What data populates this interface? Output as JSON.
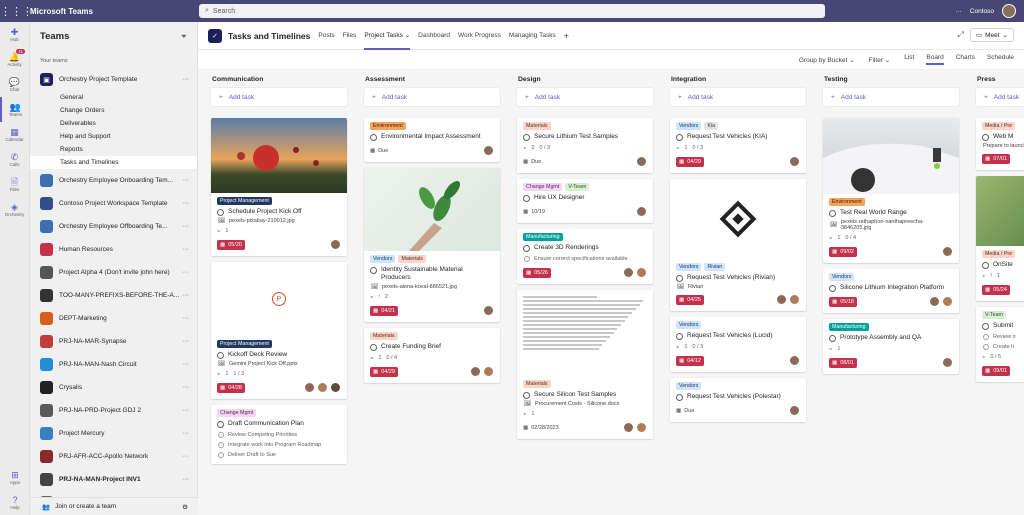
{
  "app": {
    "name": "Microsoft Teams",
    "search_placeholder": "Search",
    "org": "Contoso"
  },
  "rail": [
    {
      "label": "Hub",
      "icon": "hub-icon"
    },
    {
      "label": "Activity",
      "icon": "bell-icon",
      "badge": "11"
    },
    {
      "label": "Chat",
      "icon": "chat-icon"
    },
    {
      "label": "Teams",
      "icon": "teams-icon"
    },
    {
      "label": "Calendar",
      "icon": "calendar-icon"
    },
    {
      "label": "Calls",
      "icon": "phone-icon"
    },
    {
      "label": "Files",
      "icon": "file-icon"
    },
    {
      "label": "Orchestry",
      "icon": "orchestry-icon"
    }
  ],
  "rail_bottom": [
    {
      "label": "Apps"
    },
    {
      "label": "Help"
    }
  ],
  "panel": {
    "title": "Teams",
    "section": "Your teams",
    "team_main": "Orchestry Project Template",
    "channels": [
      "General",
      "Change Orders",
      "Deliverables",
      "Help and Support",
      "Reports",
      "Tasks and Timelines"
    ],
    "teams": [
      {
        "name": "Orchestry Employee Onboarding Tem...",
        "color": "#3a6fb0"
      },
      {
        "name": "Contoso Project Workspace Template",
        "color": "#2f4f8a"
      },
      {
        "name": "Orchestry Employee Offboarding Te...",
        "color": "#3a6fb0"
      },
      {
        "name": "Human Resources",
        "color": "#c4314b"
      },
      {
        "name": "Project Alpha 4 (Don't invite john here)",
        "color": "#555"
      },
      {
        "name": "TOO-MANY-PREFIXS-BEFORE-THE-A...",
        "color": "#333"
      },
      {
        "name": "DEPT-Marketing",
        "color": "#d65f1a"
      },
      {
        "name": "PRJ-NA-MAR-Synapse",
        "color": "#c43b3b"
      },
      {
        "name": "PRJ-NA-MAN-Nash Circuit",
        "color": "#1f8fd6"
      },
      {
        "name": "Crysalis",
        "color": "#222"
      },
      {
        "name": "PRJ-NA-PRD-Project GDJ 2",
        "color": "#5a5a5a"
      },
      {
        "name": "Project Mercury",
        "color": "#3b7fc4"
      },
      {
        "name": "PRJ-AFR-ACC-Apollo Network",
        "color": "#8a2b2b"
      },
      {
        "name": "PRJ-NA-MAN-Project INV1",
        "color": "#444",
        "bold": true
      },
      {
        "name": "EMP-ON-Mark Harrison",
        "color": "#666"
      }
    ],
    "join": "Join or create a team"
  },
  "header": {
    "title": "Tasks and Timelines",
    "tabs": [
      "Posts",
      "Files",
      "Project Tasks",
      "Dashboard",
      "Work Progress",
      "Managing Tasks"
    ],
    "active_tab": "Project Tasks",
    "meet": "Meet"
  },
  "toolbar": {
    "group": "Group by Bucket",
    "filter": "Filter",
    "views": [
      "List",
      "Board",
      "Charts",
      "Schedule"
    ],
    "active_view": "Board"
  },
  "add_task": "Add task",
  "columns": [
    {
      "title": "Communication",
      "cards": [
        {
          "image": "balloons",
          "labels": [
            [
              "pm",
              "Project Management"
            ]
          ],
          "title": "Schedule Project Kick Off",
          "attachment": "pexels-pixabay-210012.jpg",
          "meta": [
            "1"
          ],
          "due": "05/20",
          "avatars": 1
        },
        {
          "image": "ppt",
          "labels": [
            [
              "pm",
              "Project Management"
            ]
          ],
          "title": "Kickoff Deck Review",
          "attachment": "Gemini Project Kick Off.pptx",
          "meta": [
            "1",
            "1 / 3"
          ],
          "due": "04/28",
          "avatars": 3
        },
        {
          "labels": [
            [
              "cm",
              "Change Mgmt"
            ]
          ],
          "title": "Draft Communication Plan",
          "checklist": [
            "Review Competing Priorities",
            "Integrate work into Program Roadmap",
            "Deliver Draft to Sue"
          ]
        }
      ]
    },
    {
      "title": "Assessment",
      "cards": [
        {
          "labels": [
            [
              "env",
              "Environment"
            ]
          ],
          "title": "Environmental Impact Assessment",
          "due_plain": "Due",
          "avatars": 1
        },
        {
          "image": "plant",
          "labels": [
            [
              "ven",
              "Vendors"
            ],
            [
              "mat",
              "Materials"
            ]
          ],
          "title": "Identity Sustainable Material Producers",
          "attachment": "pexels-alena-koval-886521.jpg",
          "meta": [
            "!",
            "2"
          ],
          "due": "04/21",
          "avatars": 1
        },
        {
          "labels": [
            [
              "mat",
              "Materials"
            ]
          ],
          "title": "Create Funding Brief",
          "meta": [
            "1",
            "0 / 4"
          ],
          "due": "04/29",
          "avatars": 2
        }
      ]
    },
    {
      "title": "Design",
      "cards": [
        {
          "labels": [
            [
              "mat",
              "Materials"
            ]
          ],
          "title": "Secure Lithium Test Samples",
          "meta": [
            "2",
            "0 / 3"
          ],
          "due_plain": "Due",
          "avatars": 1
        },
        {
          "labels": [
            [
              "cm",
              "Change Mgmt"
            ],
            [
              "vt",
              "V-Team"
            ]
          ],
          "title": "Hire UX Designer",
          "due_plain": "10/19",
          "avatars": 1
        },
        {
          "labels": [
            [
              "mfg",
              "Manufacturing"
            ]
          ],
          "title": "Create 3D Renderings",
          "checklist": [
            "Ensure correct specifications available"
          ],
          "due": "05/26",
          "avatars": 2
        },
        {
          "image": "doc",
          "labels": [
            [
              "mat",
              "Materials"
            ]
          ],
          "title": "Secure Silicon Test Samples",
          "attachment": "Procurement Costs - Silicone.docx",
          "meta": [
            "1"
          ],
          "due_plain": "02/28/2023",
          "avatars": 2
        }
      ]
    },
    {
      "title": "Integration",
      "cards": [
        {
          "labels": [
            [
              "ven",
              "Vendors"
            ],
            [
              "kia",
              "Kia"
            ]
          ],
          "title": "Request Test Vehicles (KIA)",
          "meta": [
            "1",
            "0 / 3"
          ],
          "due": "04/29",
          "avatars": 1
        },
        {
          "image": "logo",
          "labels": [
            [
              "ven",
              "Vendors"
            ],
            [
              "ven",
              "Rivian"
            ]
          ],
          "title": "Request Test Vehicles (Rivian)",
          "attachment": "Rivian",
          "due": "04/25",
          "avatars": 2
        },
        {
          "labels": [
            [
              "ven",
              "Vendors"
            ]
          ],
          "title": "Request Test Vehicles (Lucid)",
          "meta": [
            "1",
            "0 / 3"
          ],
          "due": "04/12",
          "avatars": 1
        },
        {
          "labels": [
            [
              "ven",
              "Vendors"
            ]
          ],
          "title": "Request Test Vehicles (Polestar)",
          "due_plain": "Due",
          "avatars": 1
        }
      ]
    },
    {
      "title": "Testing",
      "cards": [
        {
          "image": "car",
          "labels": [
            [
              "env",
              "Environment"
            ]
          ],
          "title": "Test Real World Range",
          "attachment": "pexels-rathaphon-nanthapreecha-3846205.jpg",
          "meta": [
            "1",
            "0 / 4"
          ],
          "due": "09/02",
          "avatars": 1
        },
        {
          "labels": [
            [
              "ven",
              "Vendors"
            ]
          ],
          "title": "Silicone Lithium Integration Platform",
          "due": "05/18",
          "avatars": 2
        },
        {
          "labels": [
            [
              "mfg",
              "Manufacturing"
            ]
          ],
          "title": "Prototype Assembly and QA",
          "meta": [
            "1"
          ],
          "due": "08/01",
          "avatars": 1
        }
      ]
    },
    {
      "title": "Press",
      "cards": [
        {
          "labels": [
            [
              "mat",
              "Media / Pre"
            ]
          ],
          "title": "Web M",
          "desc": "Prepare to launch",
          "due": "07/01"
        },
        {
          "image": "green",
          "labels": [
            [
              "mat",
              "Media / Pre"
            ]
          ],
          "title": "OnSite",
          "meta": [
            "!",
            "1"
          ],
          "due": "05/24"
        },
        {
          "labels": [
            [
              "vt",
              "V-Team"
            ]
          ],
          "title": "Submit",
          "checklist": [
            "Review o",
            "Create Ir"
          ],
          "meta": [
            "0 / 5"
          ],
          "due": "09/01"
        }
      ]
    }
  ]
}
